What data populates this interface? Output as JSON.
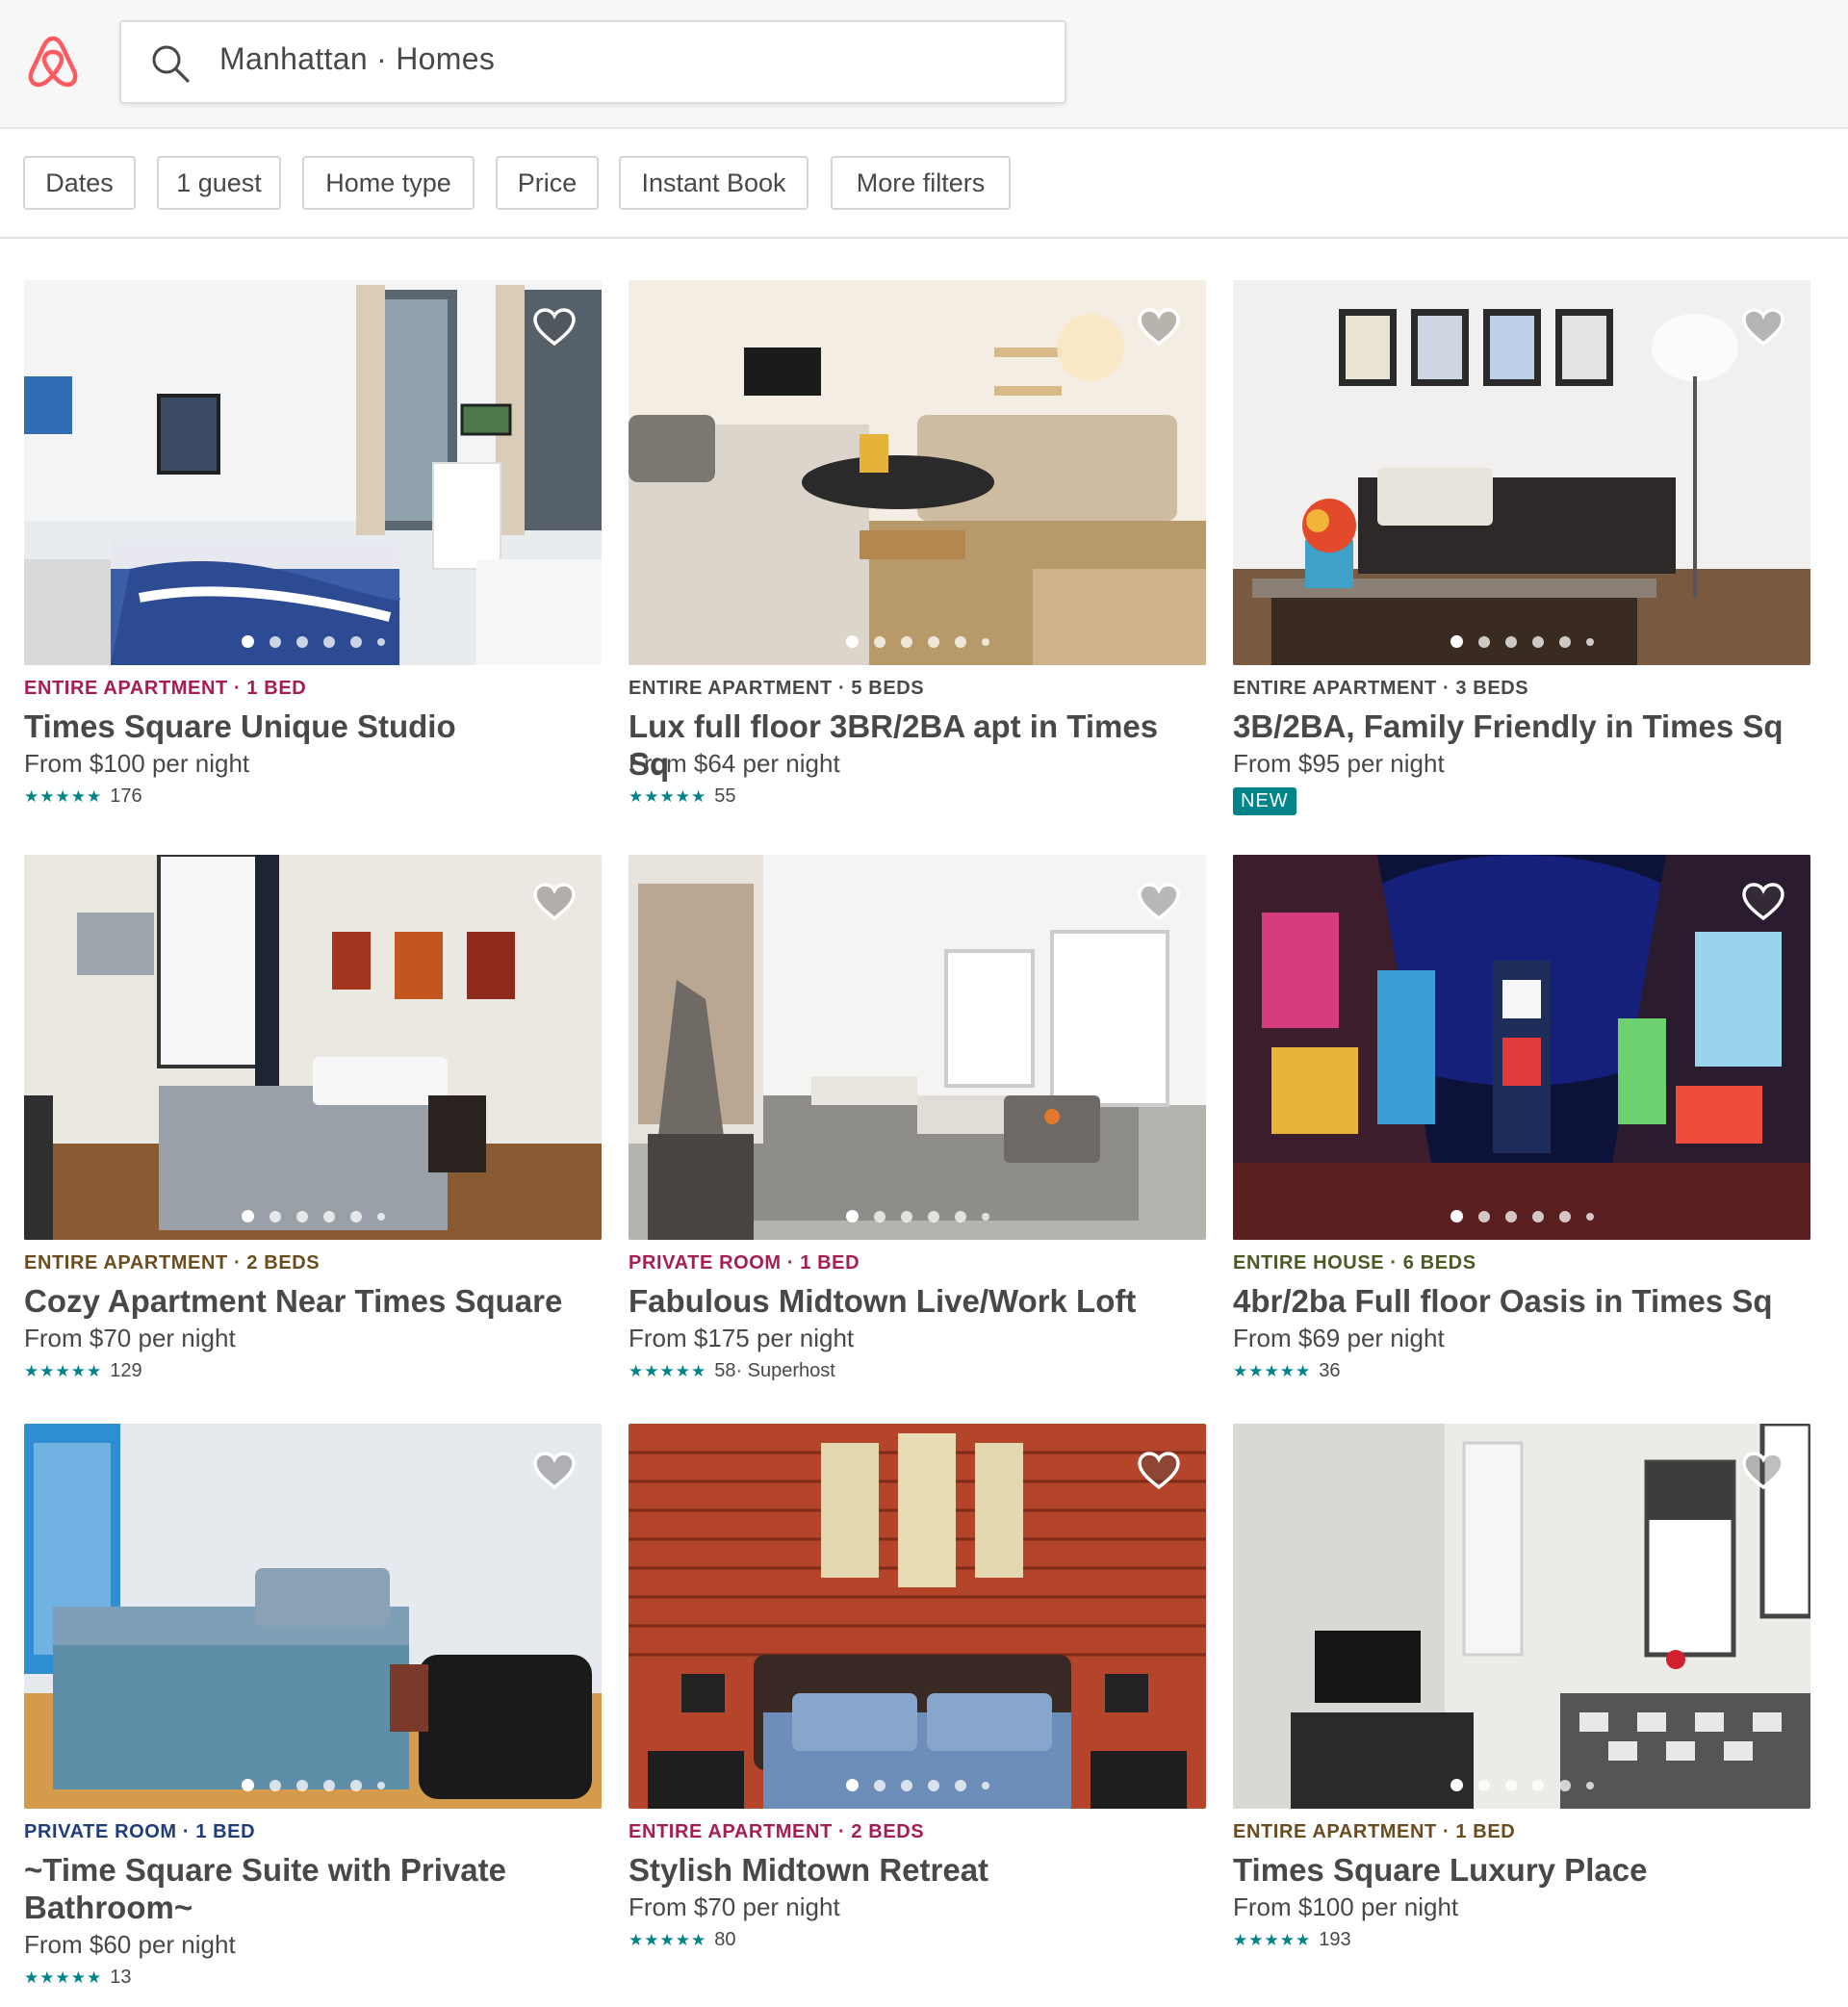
{
  "colors": {
    "brand": "#FF5A5F",
    "teal": "#008489"
  },
  "search": {
    "icon": "search-icon",
    "value": "Manhattan · Homes"
  },
  "filters": [
    "Dates",
    "1 guest",
    "Home type",
    "Price",
    "Instant Book",
    "More filters"
  ],
  "listings": [
    {
      "kicker": "ENTIRE APARTMENT · 1 BED",
      "kicker_color": "#A61D55",
      "title": "Times Square Unique Studio",
      "price": "From $100 per night",
      "stars": 4.5,
      "reviews": "176",
      "extra": "",
      "badge": ""
    },
    {
      "kicker": "ENTIRE APARTMENT · 5 BEDS",
      "kicker_color": "#484848",
      "title": "Lux full floor 3BR/2BA apt in Times Sq",
      "price": "From $64 per night",
      "stars": 4.5,
      "reviews": "55",
      "extra": "",
      "badge": ""
    },
    {
      "kicker": "ENTIRE APARTMENT · 3 BEDS",
      "kicker_color": "#484848",
      "title": "3B/2BA, Family Friendly in Times Sq",
      "price": "From $95 per night",
      "stars": 0,
      "reviews": "",
      "extra": "",
      "badge": "NEW"
    },
    {
      "kicker": "ENTIRE APARTMENT · 2 BEDS",
      "kicker_color": "#6B4C1E",
      "title": "Cozy Apartment Near Times Square",
      "price": "From $70 per night",
      "stars": 4.5,
      "reviews": "129",
      "extra": "",
      "badge": ""
    },
    {
      "kicker": "PRIVATE ROOM · 1 BED",
      "kicker_color": "#A61D55",
      "title": "Fabulous Midtown Live/Work Loft",
      "price": "From $175 per night",
      "stars": 5,
      "reviews": "58",
      "extra": " · Superhost",
      "badge": ""
    },
    {
      "kicker": "ENTIRE HOUSE · 6 BEDS",
      "kicker_color": "#4A5A24",
      "title": "4br/2ba Full floor Oasis in Times Sq",
      "price": "From $69 per night",
      "stars": 4.5,
      "reviews": "36",
      "extra": "",
      "badge": ""
    },
    {
      "kicker": "PRIVATE ROOM · 1 BED",
      "kicker_color": "#1F3D7A",
      "title": "~Time Square Suite with Private Bathroom~",
      "price": "From $60 per night",
      "stars": 4.5,
      "reviews": "13",
      "extra": "",
      "badge": ""
    },
    {
      "kicker": "ENTIRE APARTMENT · 2 BEDS",
      "kicker_color": "#A61D55",
      "title": "Stylish Midtown Retreat",
      "price": "From $70 per night",
      "stars": 4.5,
      "reviews": "80",
      "extra": "",
      "badge": ""
    },
    {
      "kicker": "ENTIRE APARTMENT · 1 BED",
      "kicker_color": "#6B4C1E",
      "title": "Times Square Luxury Place",
      "price": "From $100 per night",
      "stars": 4.5,
      "reviews": "193",
      "extra": "",
      "badge": ""
    }
  ]
}
